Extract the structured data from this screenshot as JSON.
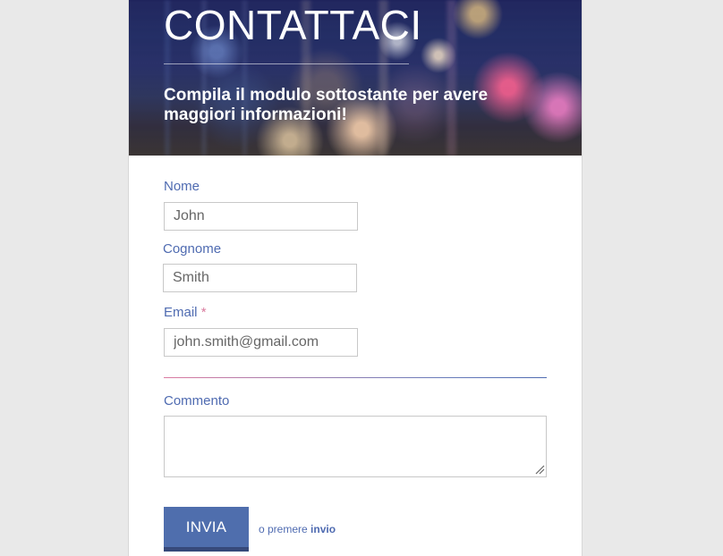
{
  "page": {
    "background_color": "#e9e9e9",
    "card_color": "#ffffff",
    "accent_color": "#4f6bb1",
    "required_color": "#d97b9e"
  },
  "header": {
    "title": "CONTATTACI",
    "subtitle": "Compila il modulo sottostante per avere maggiori informazioni!"
  },
  "form": {
    "first_name": {
      "label": "Nome",
      "value": "John"
    },
    "last_name": {
      "label": "Cognome",
      "value": "Smith"
    },
    "email": {
      "label": "Email",
      "required_mark": "*",
      "value": "john.smith@gmail.com"
    },
    "comment": {
      "label": "Commento",
      "value": ""
    },
    "submit": {
      "label": "INVIA",
      "hint_prefix": "o premere",
      "hint_key": "invio"
    }
  },
  "icons": {
    "resize_handle": "resize-handle-icon"
  }
}
